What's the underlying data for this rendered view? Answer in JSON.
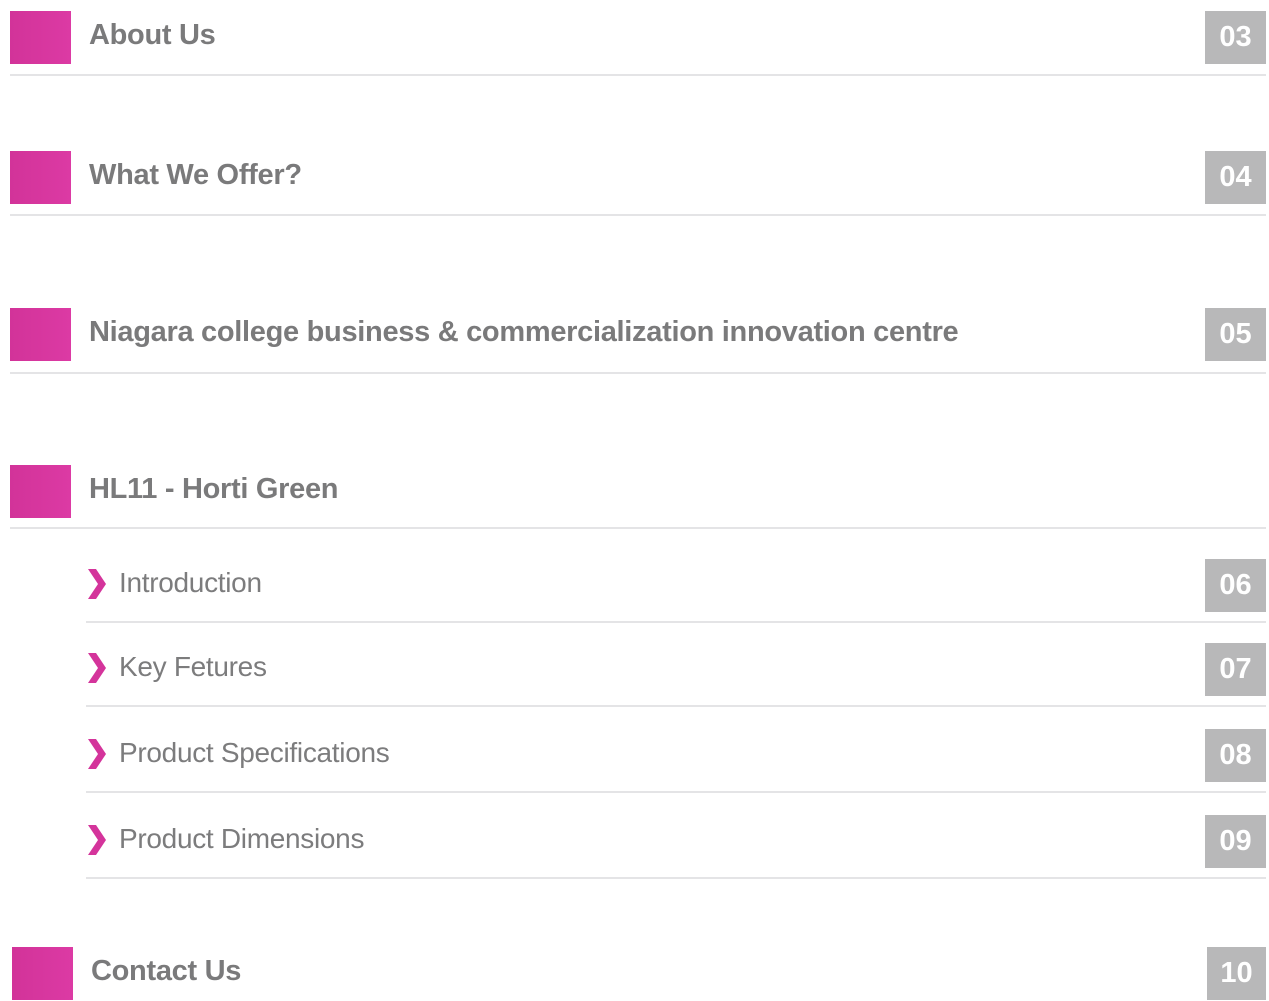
{
  "toc": {
    "about": {
      "title": "About Us",
      "page": "03"
    },
    "offer": {
      "title": "What We Offer?",
      "page": "04"
    },
    "niagara": {
      "title": "Niagara college business & commercialization innovation centre",
      "page": "05"
    },
    "hl11": {
      "title": "HL11 - Horti Green",
      "subitems": [
        {
          "title": "Introduction",
          "page": "06"
        },
        {
          "title": "Key Fetures",
          "page": "07"
        },
        {
          "title": "Product Specifications",
          "page": "08"
        },
        {
          "title": "Product Dimensions",
          "page": "09"
        }
      ]
    },
    "contact": {
      "title": "Contact Us",
      "page": "10"
    }
  },
  "colors": {
    "accent": "#d4349b",
    "number_bg": "#b8b8b9",
    "text": "#7a7a7b",
    "divider": "#e4e4e6"
  },
  "icons": {
    "section_marker": "magenta-square",
    "subitem_marker": "chevron-right-icon"
  }
}
